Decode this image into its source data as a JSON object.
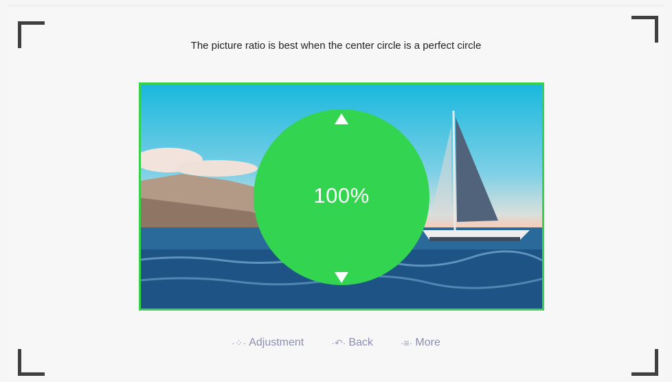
{
  "instruction": "The picture ratio is best when the center circle is a perfect circle",
  "ratio_label": "100%",
  "controls": {
    "adjustment": {
      "icon": "dpad-icon",
      "label": "Adjustment"
    },
    "back": {
      "icon": "back-icon",
      "label": "Back"
    },
    "more": {
      "icon": "menu-icon",
      "label": "More"
    }
  },
  "colors": {
    "accent": "#33d44f",
    "frame_border": "#37d24a"
  }
}
